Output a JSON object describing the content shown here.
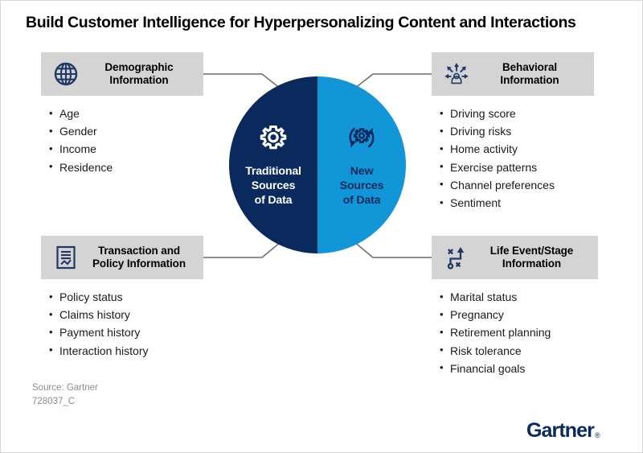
{
  "title": "Build Customer Intelligence for Hyperpersonalizing Content and Interactions",
  "colors": {
    "navy": "#0a2a5e",
    "light_blue": "#1296d8",
    "header_gray": "#d4d4d4",
    "connector_gray": "#6e6e6e",
    "source_gray": "#8c8c8c"
  },
  "center": {
    "left": {
      "icon": "gear-icon",
      "line1": "Traditional",
      "line2": "Sources",
      "line3": "of Data"
    },
    "right": {
      "icon": "gear-refresh-icon",
      "line1": "New",
      "line2": "Sources",
      "line3": "of Data"
    }
  },
  "cards": {
    "demographic": {
      "icon": "globe-icon",
      "title_line1": "Demographic",
      "title_line2": "Information",
      "items": [
        "Age",
        "Gender",
        "Income",
        "Residence"
      ]
    },
    "behavioral": {
      "icon": "person-arrows-icon",
      "title_line1": "Behavioral",
      "title_line2": "Information",
      "items": [
        "Driving score",
        "Driving risks",
        "Home activity",
        "Exercise patterns",
        "Channel preferences",
        "Sentiment"
      ]
    },
    "transaction": {
      "icon": "document-chart-icon",
      "title_line1": "Transaction and",
      "title_line2": "Policy Information",
      "items": [
        "Policy status",
        "Claims history",
        "Payment history",
        "Interaction history"
      ]
    },
    "lifeevent": {
      "icon": "strategy-path-icon",
      "title_line1": "Life Event/Stage",
      "title_line2": "Information",
      "items": [
        "Marital status",
        "Pregnancy",
        "Retirement planning",
        "Risk tolerance",
        "Financial goals"
      ]
    }
  },
  "footer": {
    "source": "Source: Gartner",
    "doc_id": "728037_C",
    "logo_text": "Gartner",
    "logo_mark": "®"
  }
}
